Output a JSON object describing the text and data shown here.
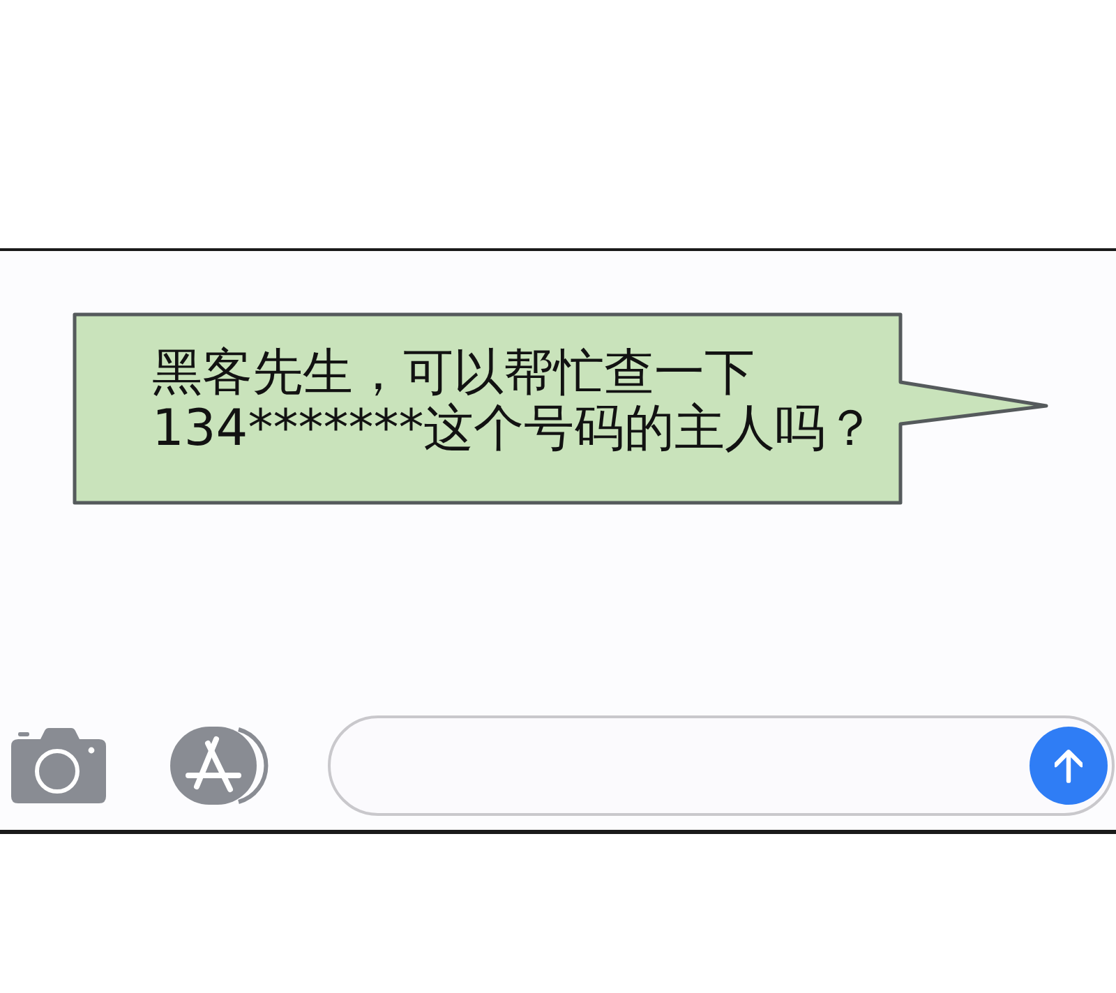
{
  "message": {
    "text": "黑客先生，可以帮忙查一下\n134*******这个号码的主人吗？"
  },
  "send_button": {
    "disabled": false
  }
}
